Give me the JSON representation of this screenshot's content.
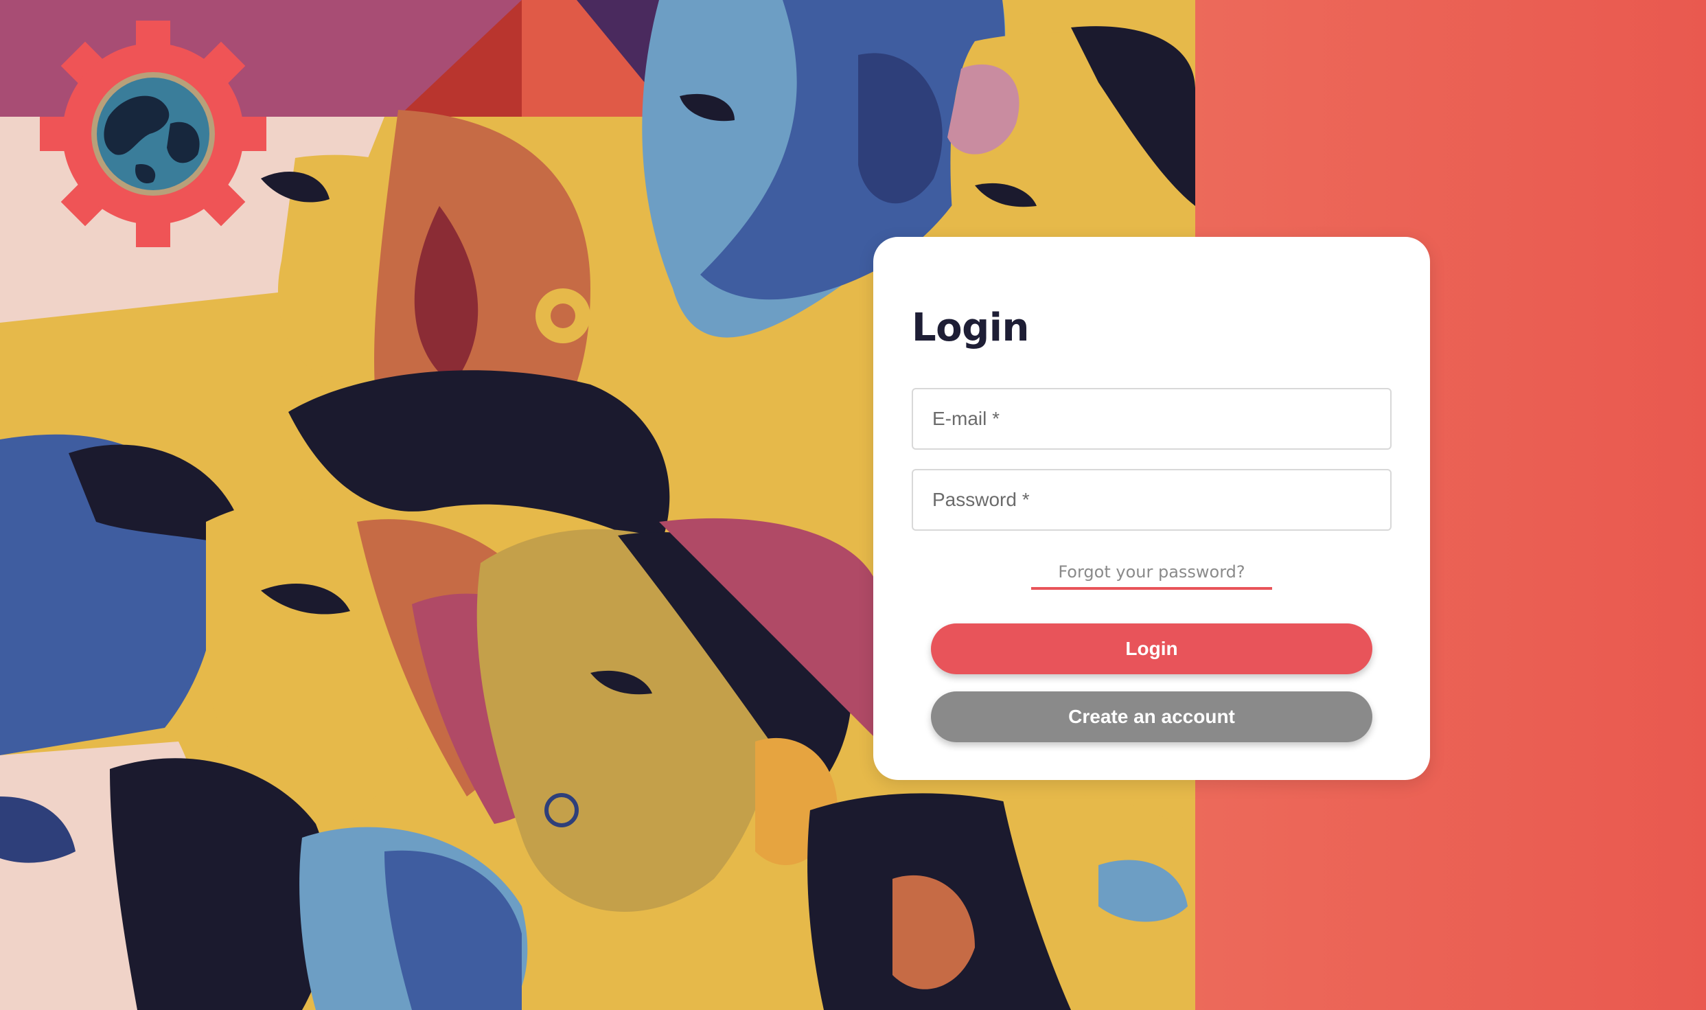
{
  "login_card": {
    "title": "Login",
    "email_placeholder": "E-mail *",
    "password_placeholder": "Password *",
    "forgot_password": "Forgot your password?",
    "login_button": "Login",
    "create_account_button": "Create an account"
  },
  "colors": {
    "accent": "#e8545a",
    "secondary_button": "#8a8a8a",
    "title_text": "#1e1e35",
    "right_background": "#ee7260"
  },
  "icons": {
    "logo": "gear-globe-icon"
  }
}
